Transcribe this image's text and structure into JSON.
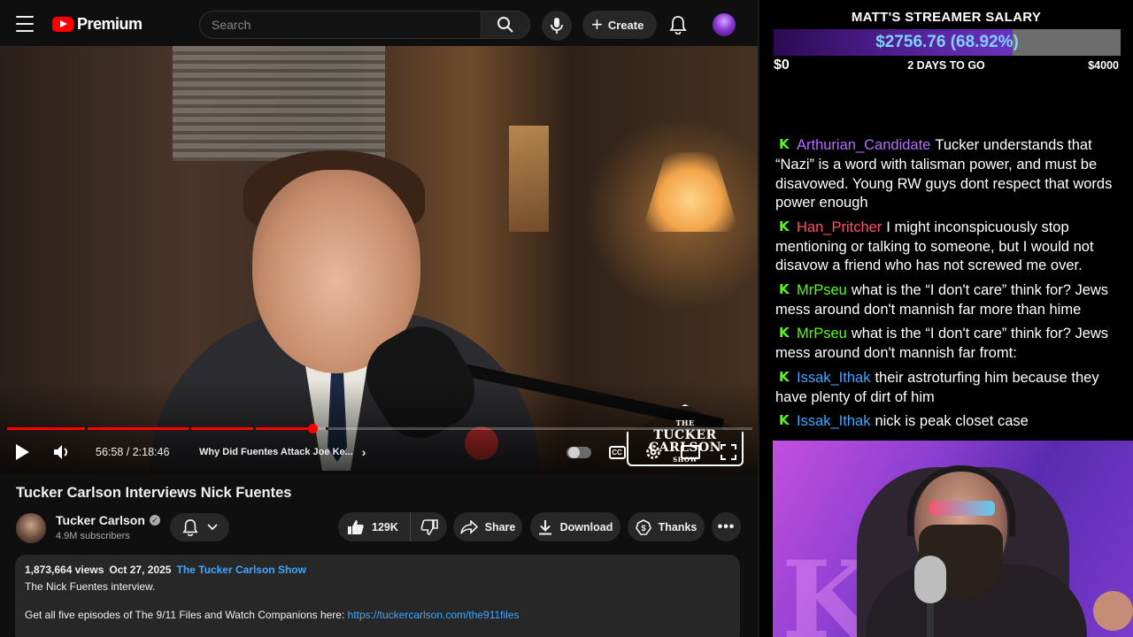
{
  "youtube": {
    "header": {
      "brand": "Premium",
      "search_placeholder": "Search",
      "create_label": "Create"
    },
    "player": {
      "current_time": "56:58",
      "duration": "2:18:46",
      "time_display": "56:58 / 2:18:46",
      "played_fraction": 0.41,
      "buffered_fraction": 0.415,
      "chapter_title": "Why Did Fuentes Attack Joe Ke...",
      "watermark_lines": [
        "THE",
        "TUCKER",
        "CARLSON",
        "SHOW"
      ]
    },
    "video": {
      "title": "Tucker Carlson Interviews Nick Fuentes",
      "channel_name": "Tucker Carlson",
      "subscribers": "4.9M subscribers",
      "likes": "129K",
      "share_label": "Share",
      "download_label": "Download",
      "thanks_label": "Thanks"
    },
    "description": {
      "views": "1,873,664 views",
      "date": "Oct 27, 2025",
      "show_link": "The Tucker Carlson Show",
      "line1": "The Nick Fuentes interview.",
      "line2": "Get all five episodes of The 9/11 Files and Watch Companions here: ",
      "url": "https://tuckercarlson.com/the911files"
    }
  },
  "overlay": {
    "goal": {
      "title": "MATT'S STREAMER SALARY",
      "amount": "$2756.76 (68.92%)",
      "fraction": 0.6892,
      "min": "$0",
      "days": "2 DAYS TO GO",
      "max": "$4000"
    },
    "chat": [
      {
        "user": "Arthurian_Candidate",
        "color": "#b86bff",
        "text": "Tucker understands that “Nazi” is a word with talisman power, and must be disavowed. Young RW guys dont respect that words power enough"
      },
      {
        "user": "Han_Pritcher",
        "color": "#ff4f6a",
        "text": "I might inconspicuously stop mentioning or talking to someone, but I would not disavow a friend who has not screwed me over."
      },
      {
        "user": "MrPseu",
        "color": "#53fc18",
        "text": "what is the “I don't care” think for? Jews mess around don't mannish far more than hime"
      },
      {
        "user": "MrPseu",
        "color": "#53fc18",
        "text": "what is the “I don't care” think for? Jews mess around don't mannish far fromt:"
      },
      {
        "user": "Issak_Ithak",
        "color": "#3ea6ff",
        "text": "their astroturfing him because they have plenty of dirt of him"
      },
      {
        "user": "Issak_Ithak",
        "color": "#3ea6ff",
        "text": "nick is peak closet case"
      }
    ]
  }
}
